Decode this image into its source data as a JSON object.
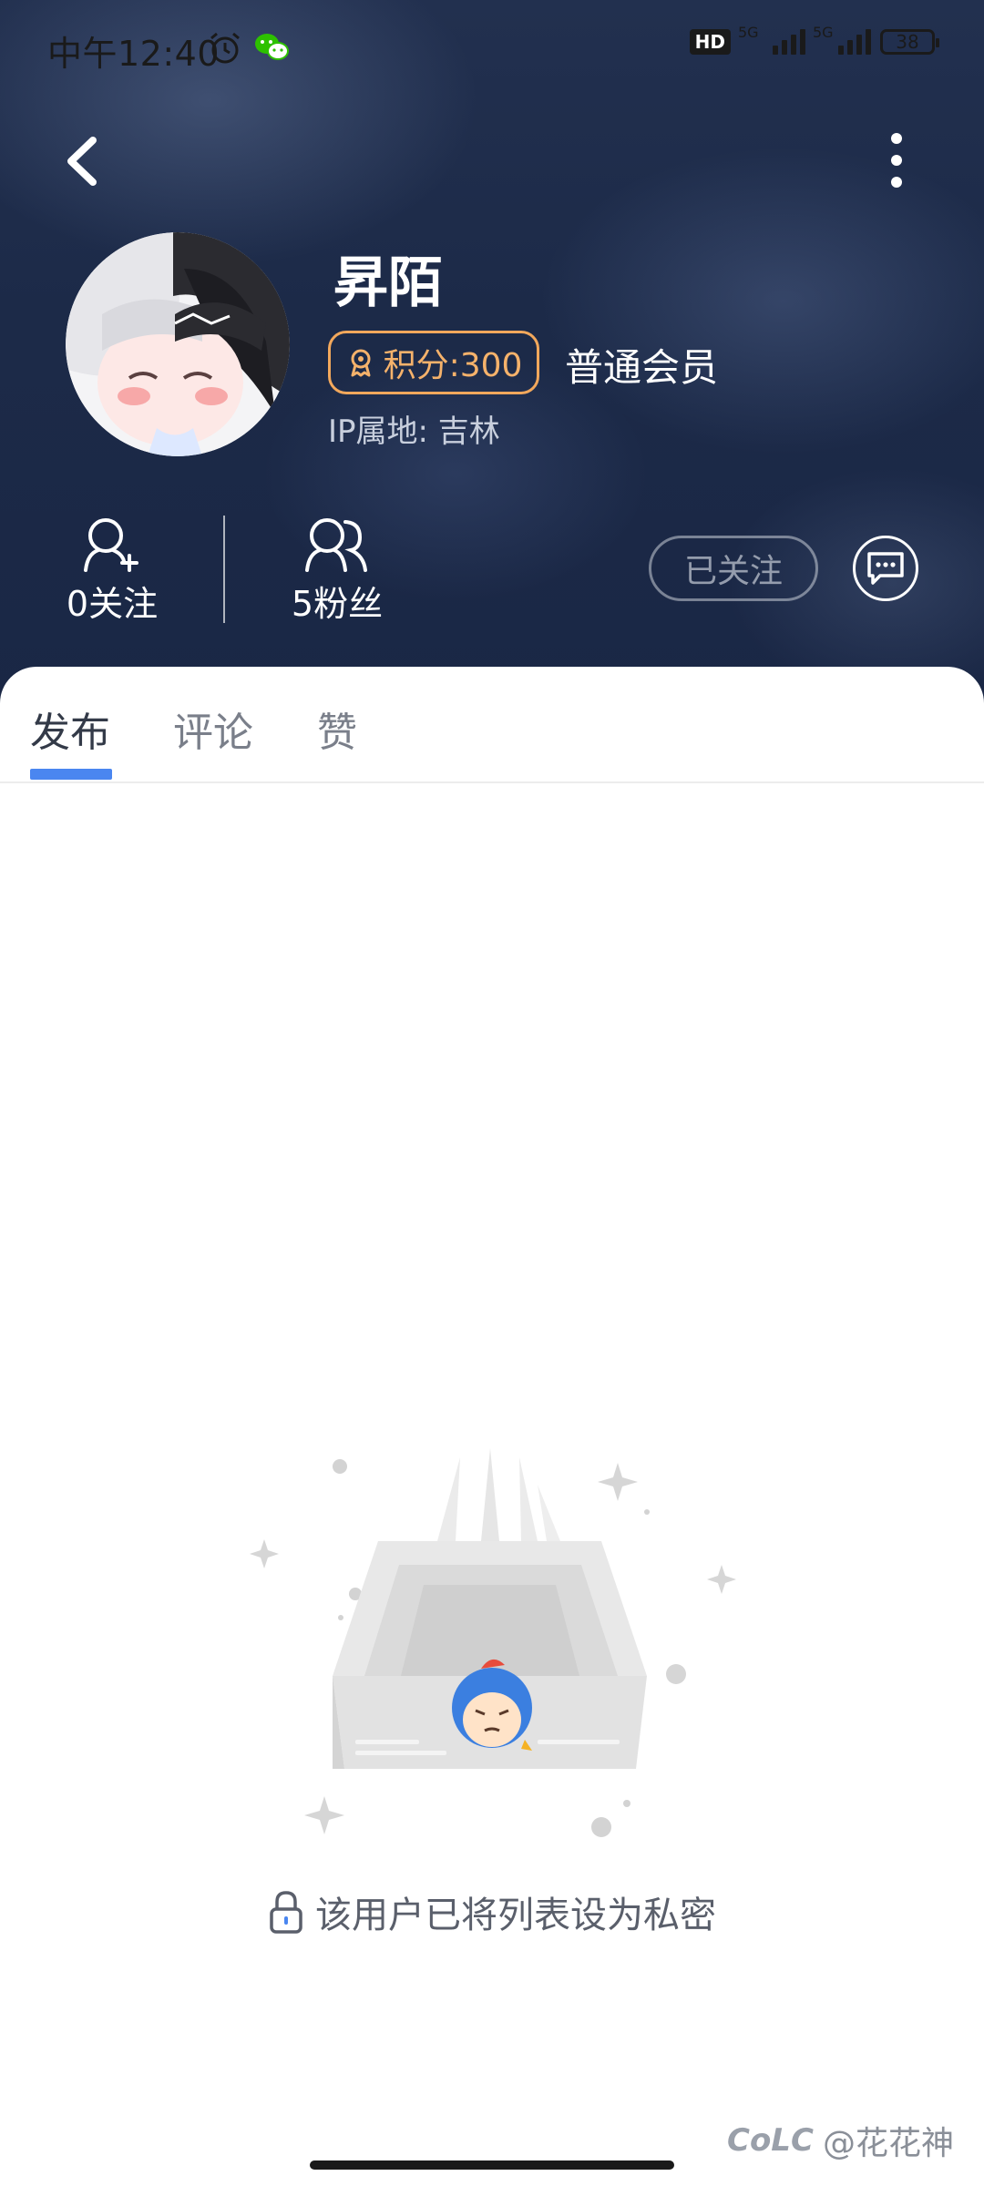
{
  "status_bar": {
    "time": "中午12:40",
    "network_badge": "HD",
    "signal1_label": "5G",
    "signal2_label": "5G",
    "battery": "38"
  },
  "profile": {
    "username": "昇陌",
    "points_label": "积分:300",
    "member_level": "普通会员",
    "ip_location": "IP属地: 吉林",
    "following": "0关注",
    "followers": "5粉丝",
    "follow_button": "已关注"
  },
  "tabs": [
    {
      "label": "发布",
      "active": true
    },
    {
      "label": "评论",
      "active": false
    },
    {
      "label": "赞",
      "active": false
    }
  ],
  "empty_state": {
    "message": "该用户已将列表设为私密"
  },
  "watermark": {
    "logo": "CoLC",
    "text": "@花花神"
  },
  "colors": {
    "accent": "#4a86f0",
    "points_orange": "#f5b26b",
    "header_bg": "#1c2a48"
  }
}
